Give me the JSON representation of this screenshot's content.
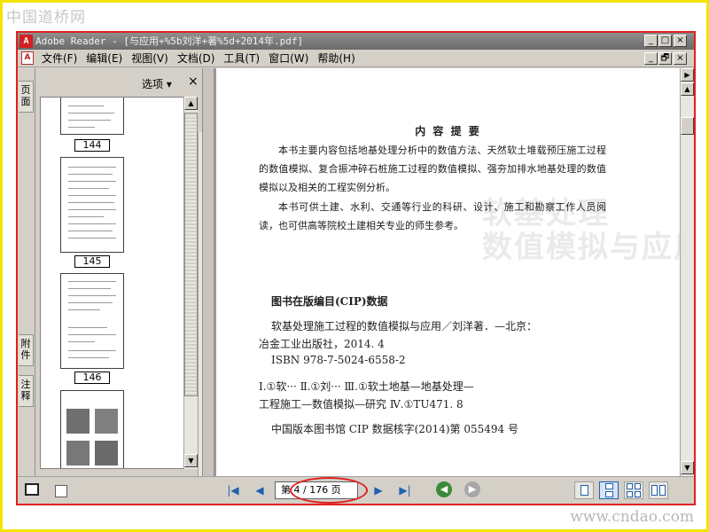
{
  "watermark": {
    "top": "中国道桥网",
    "bottom": "www.cndao.com"
  },
  "window": {
    "title": "Adobe Reader - [与应用+%5b刘洋+著%5d+2014年.pdf]",
    "controls": {
      "minimize": "_",
      "maximize": "□",
      "close": "×",
      "restore": "🗗"
    }
  },
  "menu": {
    "items": [
      "文件(F)",
      "编辑(E)",
      "视图(V)",
      "文档(D)",
      "工具(T)",
      "窗口(W)",
      "帮助(H)"
    ]
  },
  "nav_tabs": {
    "pages": "页面",
    "attachments": "附件",
    "comments": "注释"
  },
  "thumbnails_panel": {
    "options_label": "选项 ▾",
    "close_label": "×",
    "pages": [
      "144",
      "145",
      "146"
    ]
  },
  "document": {
    "ghost_cover_text": "软基处理\n数值模拟与应用",
    "summary_title": "内 容 提 要",
    "paragraph1": "本书主要内容包括地基处理分析中的数值方法、天然软土堆载预压施工过程的数值模拟、复合振冲碎石桩施工过程的数值模拟、强夯加排水地基处理的数值模拟以及相关的工程实例分析。",
    "paragraph2": "本书可供土建、水利、交通等行业的科研、设计、施工和勘察工作人员阅读，也可供高等院校土建相关专业的师生参考。",
    "cip_heading": "图书在版编目(CIP)数据",
    "cip_lines": [
      "软基处理施工过程的数值模拟与应用／刘洋著．—北京：",
      "冶金工业出版社，2014. 4",
      "ISBN 978-7-5024-6558-2",
      "Ⅰ.①软···  Ⅱ.①刘···  Ⅲ.①软土地基—地基处理—",
      "工程施工—数值模拟—研究  Ⅳ.①TU471. 8",
      "中国版本图书馆 CIP 数据核字(2014)第 055494 号"
    ]
  },
  "statusbar": {
    "page_indicator": "第 4 / 176 页",
    "current_page": 4,
    "total_pages": 176
  },
  "colors": {
    "highlight_circle": "#e02020",
    "frame": "#f2e600",
    "app_border": "#e02020"
  }
}
